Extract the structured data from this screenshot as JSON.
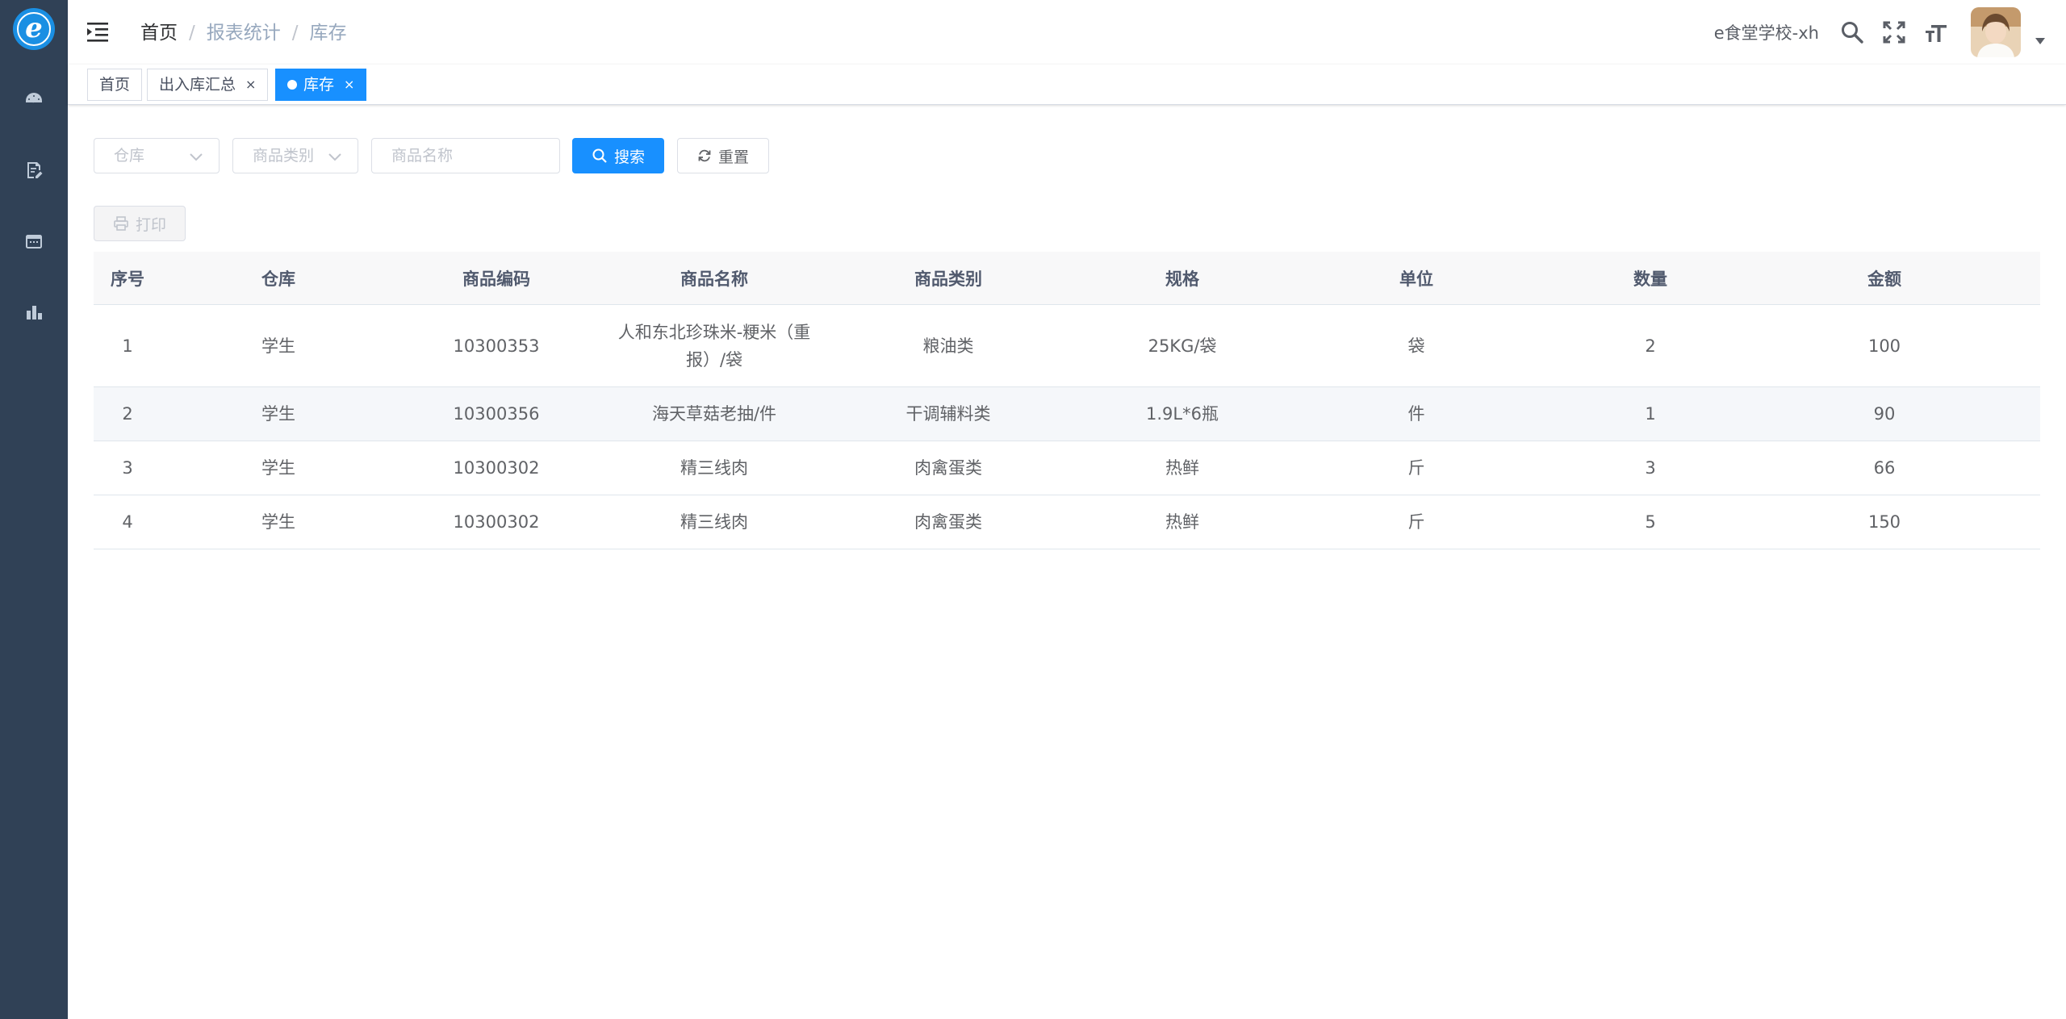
{
  "sidebar": {
    "logo_letter": "e",
    "items": [
      {
        "icon": "dashboard-icon"
      },
      {
        "icon": "document-edit-icon"
      },
      {
        "icon": "calendar-icon"
      },
      {
        "icon": "bar-chart-icon"
      }
    ]
  },
  "header": {
    "breadcrumb": [
      "首页",
      "报表统计",
      "库存"
    ],
    "username": "e食堂学校-xh"
  },
  "tags": [
    {
      "label": "首页",
      "closable": false,
      "active": false
    },
    {
      "label": "出入库汇总",
      "closable": true,
      "active": false
    },
    {
      "label": "库存",
      "closable": true,
      "active": true
    }
  ],
  "tag_close_glyph": "×",
  "filters": {
    "warehouse_placeholder": "仓库",
    "category_placeholder": "商品类别",
    "name_placeholder": "商品名称",
    "search_label": "搜索",
    "reset_label": "重置"
  },
  "toolbar": {
    "print_label": "打印"
  },
  "table": {
    "columns": [
      "序号",
      "仓库",
      "商品编码",
      "商品名称",
      "商品类别",
      "规格",
      "单位",
      "数量",
      "金额"
    ],
    "rows": [
      [
        "1",
        "学生",
        "10300353",
        "人和东北珍珠米-粳米（重报）/袋",
        "粮油类",
        "25KG/袋",
        "袋",
        "2",
        "100"
      ],
      [
        "2",
        "学生",
        "10300356",
        "海天草菇老抽/件",
        "干调辅料类",
        "1.9L*6瓶",
        "件",
        "1",
        "90"
      ],
      [
        "3",
        "学生",
        "10300302",
        "精三线肉",
        "肉禽蛋类",
        "热鲜",
        "斤",
        "3",
        "66"
      ],
      [
        "4",
        "学生",
        "10300302",
        "精三线肉",
        "肉禽蛋类",
        "热鲜",
        "斤",
        "5",
        "150"
      ]
    ]
  },
  "colors": {
    "sidebar_bg": "#304156",
    "primary": "#1890ff"
  }
}
